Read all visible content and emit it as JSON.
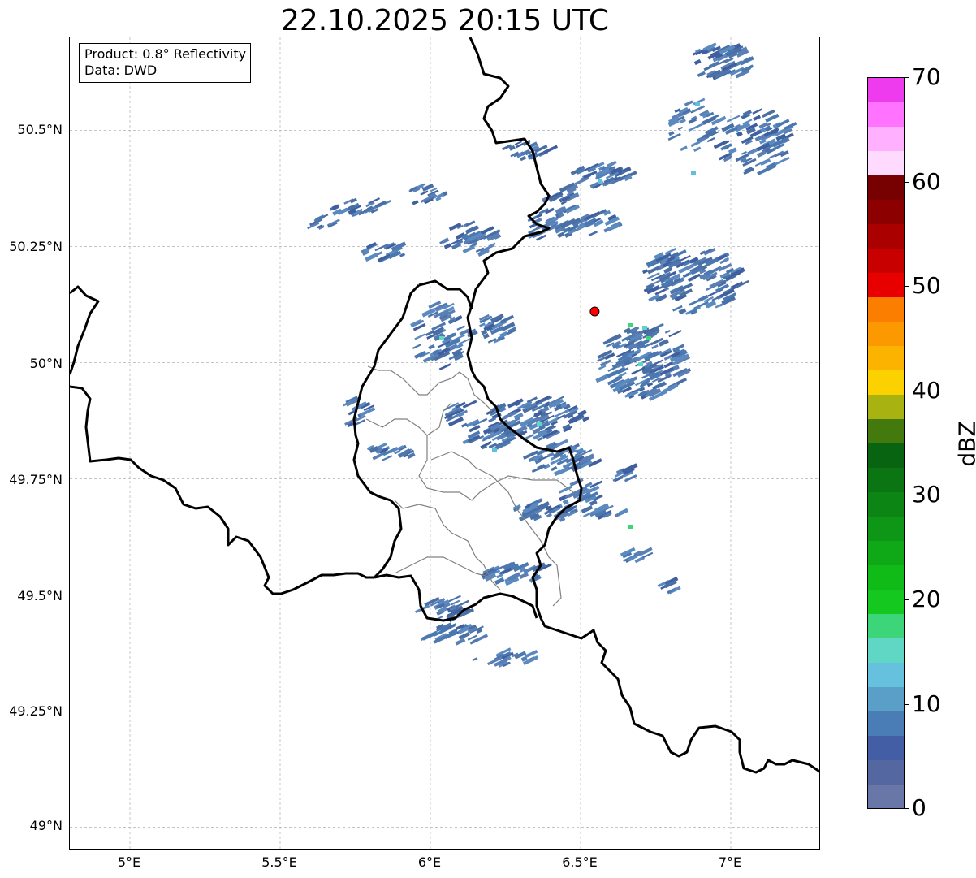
{
  "title": "22.10.2025 20:15 UTC",
  "info": {
    "product": "Product: 0.8° Reflectivity",
    "source": "Data: DWD"
  },
  "axes": {
    "lon_ticks": [
      "5°E",
      "5.5°E",
      "6°E",
      "6.5°E",
      "7°E"
    ],
    "lat_ticks": [
      "50.5°N",
      "50.25°N",
      "50°N",
      "49.75°N",
      "49.5°N",
      "49.25°N",
      "49°N"
    ],
    "lon_range": [
      4.8,
      7.3
    ],
    "lat_range": [
      48.95,
      50.7
    ]
  },
  "colorbar": {
    "unit": "dBZ",
    "min": 0,
    "max": 70,
    "tick_labels": [
      "0",
      "10",
      "20",
      "30",
      "40",
      "50",
      "60",
      "70"
    ],
    "colors": [
      "#6876a8",
      "#5467a0",
      "#435ea4",
      "#4a7db5",
      "#5a9fc8",
      "#65c1dd",
      "#60d6c5",
      "#3dd57a",
      "#14c81f",
      "#11bb17",
      "#0fa816",
      "#0e9716",
      "#0d8514",
      "#0b7513",
      "#086411",
      "#44790d",
      "#a8b211",
      "#fcd100",
      "#fcb300",
      "#fc9800",
      "#fc7e00",
      "#e80000",
      "#c90000",
      "#ab0000",
      "#8c0000",
      "#770000",
      "#ffdaff",
      "#ffb0ff",
      "#ff73ff",
      "#ee3bee"
    ]
  },
  "site_marker": {
    "lon": 6.547,
    "lat": 50.11,
    "color": "#ff0000"
  },
  "colors": {
    "border": "#000000",
    "district": "#808080",
    "grid": "#b0b0b0"
  }
}
